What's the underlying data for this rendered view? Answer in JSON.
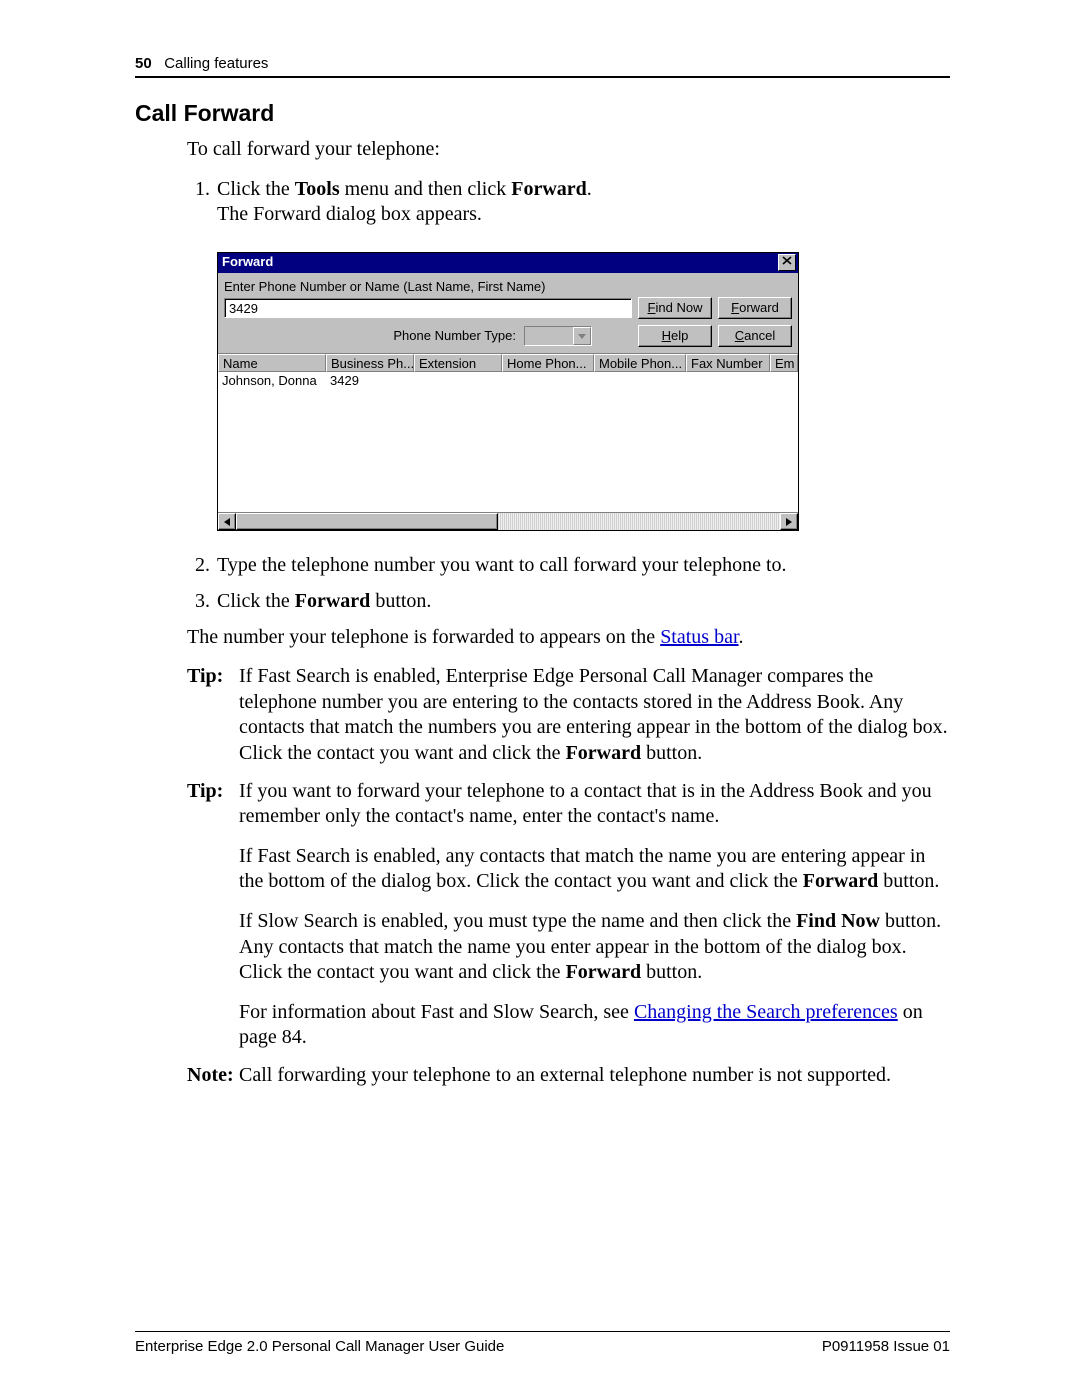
{
  "header": {
    "page_number": "50",
    "section": "Calling features"
  },
  "title": "Call Forward",
  "intro": "To call forward your telephone:",
  "steps": {
    "s1_a": "Click the ",
    "s1_tools": "Tools",
    "s1_b": " menu and then click ",
    "s1_forward": "Forward",
    "s1_c": ".",
    "s1_line2": "The Forward dialog box appears.",
    "s2": "Type the telephone number you want to call forward your telephone to.",
    "s3_a": "Click the ",
    "s3_forward": "Forward",
    "s3_b": " button."
  },
  "dialog": {
    "title": "Forward",
    "prompt": "Enter Phone Number or Name (Last Name, First Name)",
    "input_value": "3429",
    "phone_type_label": "Phone Number Type:",
    "buttons": {
      "find_now": "Find Now",
      "forward": "Forward",
      "help": "Help",
      "cancel": "Cancel"
    },
    "columns": [
      "Name",
      "Business Ph...",
      "Extension",
      "Home Phon...",
      "Mobile Phon...",
      "Fax Number",
      "Em"
    ],
    "rows": [
      {
        "name": "Johnson, Donna",
        "business": "3429"
      }
    ]
  },
  "after_steps": {
    "a": "The number your telephone is forwarded to appears on the ",
    "link": "Status bar",
    "b": "."
  },
  "tip1": {
    "label": "Tip:",
    "a": "If Fast Search is enabled, Enterprise Edge Personal Call Manager compares the telephone number you are entering to the contacts stored in the Address Book. Any contacts that match the numbers you are entering appear in the bottom of the dialog box. Click the contact you want and click the ",
    "fwd": "Forward",
    "b": " button."
  },
  "tip2": {
    "label": "Tip:",
    "p1": "If you want to forward your telephone to a contact that is in the Address Book and you remember only the contact's name, enter the contact's name.",
    "p2_a": "If Fast Search is enabled, any contacts that match the name you are entering appear in the bottom of the dialog box. Click the contact you want and click the ",
    "p2_fwd": "Forward",
    "p2_b": " button.",
    "p3_a": "If Slow Search is enabled, you must type the name and then click the ",
    "p3_find": "Find Now",
    "p3_b": " button. Any contacts that match the name you enter appear in the bottom of the dialog box. Click the contact you want and click the ",
    "p3_fwd": "Forward",
    "p3_c": " button.",
    "p4_a": "For information about Fast and Slow Search, see ",
    "p4_link": "Changing the Search preferences",
    "p4_b": " on page 84."
  },
  "note": {
    "label": "Note:",
    "text": "Call forwarding your telephone to an external telephone number is not supported."
  },
  "footer": {
    "left": "Enterprise Edge 2.0 Personal Call Manager User Guide",
    "right": "P0911958 Issue 01"
  }
}
